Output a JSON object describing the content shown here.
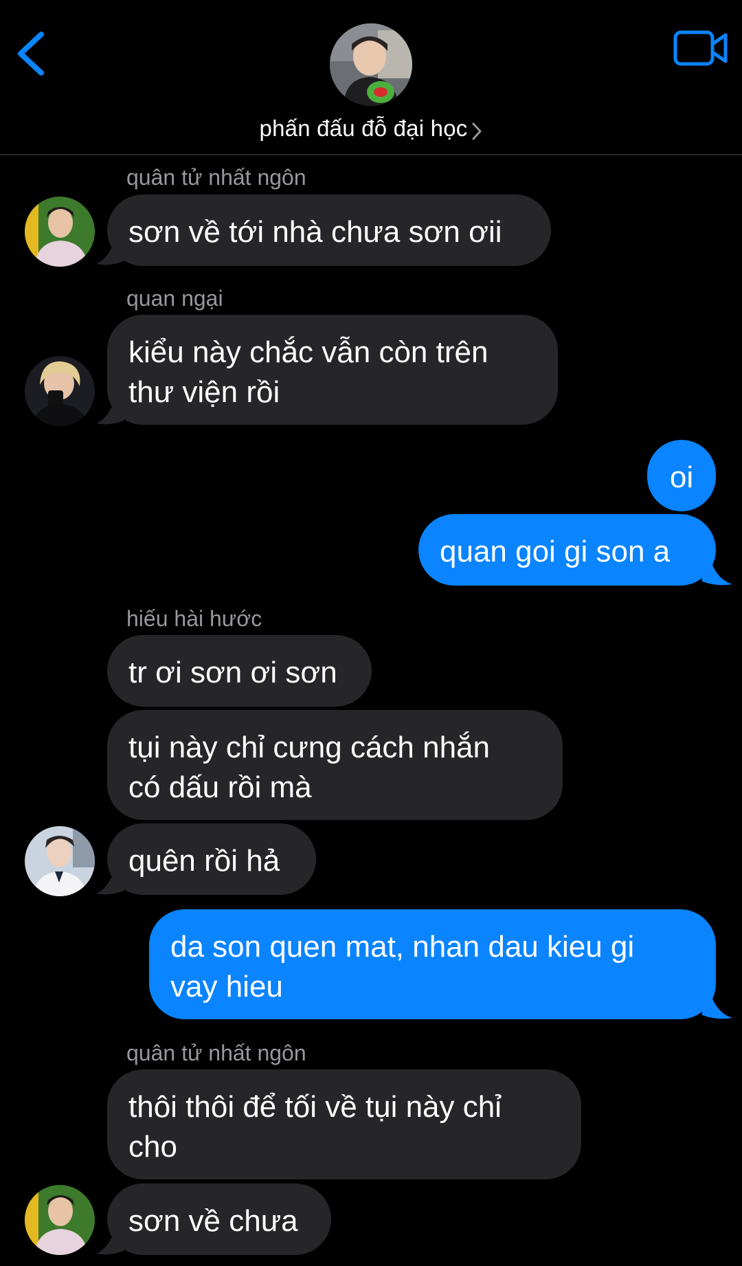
{
  "header": {
    "group_name": "phấn đấu đỗ đại học",
    "back_icon": "chevron-left-icon",
    "video_icon": "video-camera-icon",
    "accent_color": "#0a84ff"
  },
  "messages": [
    {
      "sender": "quân tử nhất ngôn",
      "text": "sơn về tới nhà chưa sơn ơii"
    },
    {
      "sender": "quan ngại",
      "text": "kiểu này chắc vẫn còn trên\nthư viện rồi"
    },
    {
      "text": "oi",
      "outgoing": true
    },
    {
      "text": "quan goi gi son a",
      "outgoing": true
    },
    {
      "sender": "hiếu hài hước",
      "text": "tr ơi sơn ơi sơn"
    },
    {
      "text": "tụi này chỉ cưng cách nhắn\ncó dấu rồi mà"
    },
    {
      "text": "quên rồi hả"
    },
    {
      "text": "da son quen mat, nhan dau kieu gi\nvay hieu",
      "outgoing": true
    },
    {
      "sender": "quân tử nhất ngôn",
      "text": "thôi thôi để tối về tụi này chỉ\ncho"
    },
    {
      "text": "sơn về chưa"
    }
  ],
  "colors": {
    "incoming_bubble": "#262628",
    "outgoing_bubble": "#0a84ff",
    "sender_label": "#98989d"
  }
}
